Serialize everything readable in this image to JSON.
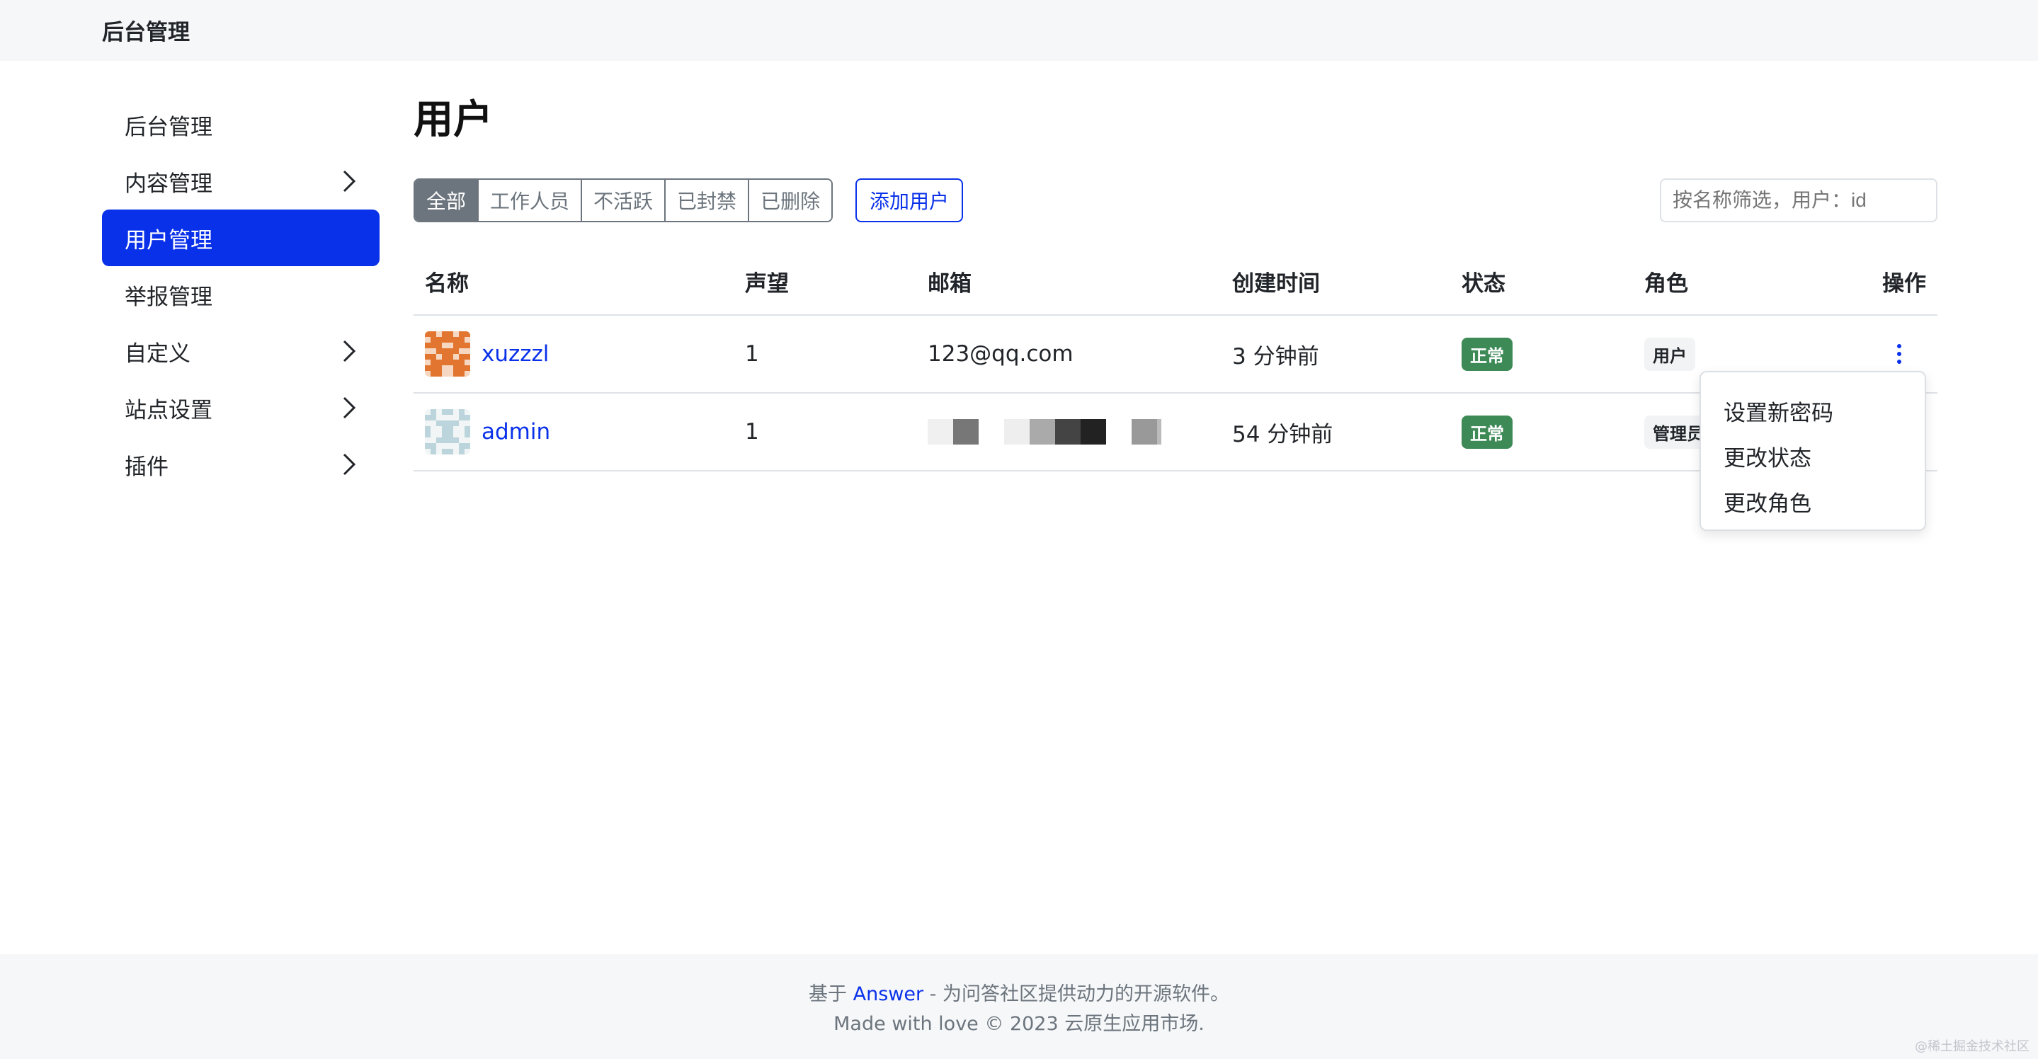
{
  "header": {
    "brand": "后台管理"
  },
  "sidebar": {
    "items": [
      {
        "label": "后台管理",
        "has_children": false,
        "active": false
      },
      {
        "label": "内容管理",
        "has_children": true,
        "active": false
      },
      {
        "label": "用户管理",
        "has_children": false,
        "active": true
      },
      {
        "label": "举报管理",
        "has_children": false,
        "active": false
      },
      {
        "label": "自定义",
        "has_children": true,
        "active": false
      },
      {
        "label": "站点设置",
        "has_children": true,
        "active": false
      },
      {
        "label": "插件",
        "has_children": true,
        "active": false
      }
    ]
  },
  "main": {
    "title": "用户",
    "filters": [
      {
        "label": "全部",
        "active": true
      },
      {
        "label": "工作人员",
        "active": false
      },
      {
        "label": "不活跃",
        "active": false
      },
      {
        "label": "已封禁",
        "active": false
      },
      {
        "label": "已删除",
        "active": false
      }
    ],
    "add_user_label": "添加用户",
    "search_placeholder": "按名称筛选，用户：id"
  },
  "table": {
    "columns": [
      "名称",
      "声望",
      "邮箱",
      "创建时间",
      "状态",
      "角色",
      "操作"
    ],
    "rows": [
      {
        "name": "xuzzzl",
        "reputation": "1",
        "email": "123@qq.com",
        "created": "3 分钟前",
        "status": "正常",
        "role": "用户"
      },
      {
        "name": "admin",
        "reputation": "1",
        "email": "",
        "created": "54 分钟前",
        "status": "正常",
        "role": "管理员"
      }
    ]
  },
  "dropdown": {
    "items": [
      "设置新密码",
      "更改状态",
      "更改角色"
    ]
  },
  "footer": {
    "prefix": "基于",
    "link": "Answer",
    "suffix": "- 为问答社区提供动力的开源软件。",
    "line2": "Made with love © 2023 云原生应用市场."
  },
  "watermark": "@稀土掘金技术社区",
  "colors": {
    "primary": "#0a31ea",
    "success": "#3d8a57",
    "secondary": "#6c757d",
    "avatar_orange": "#e2752f",
    "avatar_pale": "#bcd4db"
  }
}
